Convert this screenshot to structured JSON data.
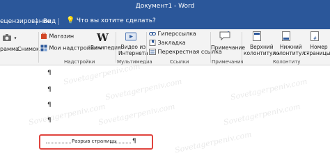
{
  "window": {
    "title": "Документ1 - Word"
  },
  "tabs": [
    {
      "label": "ецензирование"
    },
    {
      "label": "Вид"
    }
  ],
  "tellme": {
    "label": "Что вы хотите сделать?"
  },
  "ribbon": {
    "pictures_label": "рамма",
    "screenshot_label": "Снимок",
    "store_label": "Магазин",
    "addins_label": "Мои надстройки",
    "wikipedia_label": "Википедия",
    "video_label_1": "Видео из",
    "video_label_2": "Интернета",
    "hyperlink_label": "Гиперссылка",
    "bookmark_label": "Закладка",
    "crossref_label": "Перекрестная ссылка",
    "comment_label": "Примечание",
    "header_label_1": "Верхний",
    "header_label_2": "колонтитул",
    "footer_label_1": "Нижний",
    "footer_label_2": "колонтитул",
    "pagenum_label_1": "Номер",
    "pagenum_label_2": "страницы",
    "groups": {
      "addins": "Надстройки",
      "multimedia": "Мультимедиа",
      "links": "Ссылки",
      "comments": "Примечания",
      "headerfooter": "Колонтиту"
    }
  },
  "document": {
    "paragraph_mark": "¶",
    "page_break_label": "Разрыв страницы"
  },
  "watermark": {
    "text": "Sovetagerpeniv.com"
  },
  "colors": {
    "accent": "#2b579a",
    "highlight": "#e0443e"
  }
}
